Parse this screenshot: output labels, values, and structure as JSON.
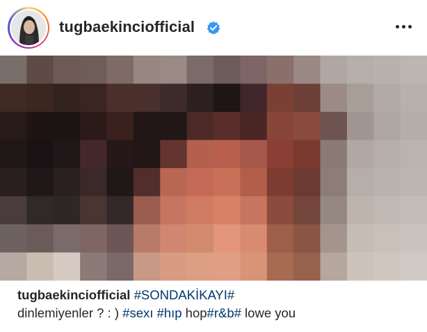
{
  "header": {
    "username": "tugbaekinciofficial",
    "verified_icon": "verified-badge-icon",
    "more_icon": "more-options-icon"
  },
  "colors": {
    "link": "#00376b",
    "text": "#262626",
    "verified": "#3897f0"
  },
  "caption": {
    "username": "tugbaekinciofficial",
    "line1_tag": "#SONDAKİKAYI#",
    "line2_text": "dinlemiyenler ? : ) ",
    "tag_sexi": "#sexı",
    "tag_hip": "#hıp",
    "hop_text": " hop",
    "tag_rb": "#r&b#",
    "ending": "  lowe you"
  }
}
